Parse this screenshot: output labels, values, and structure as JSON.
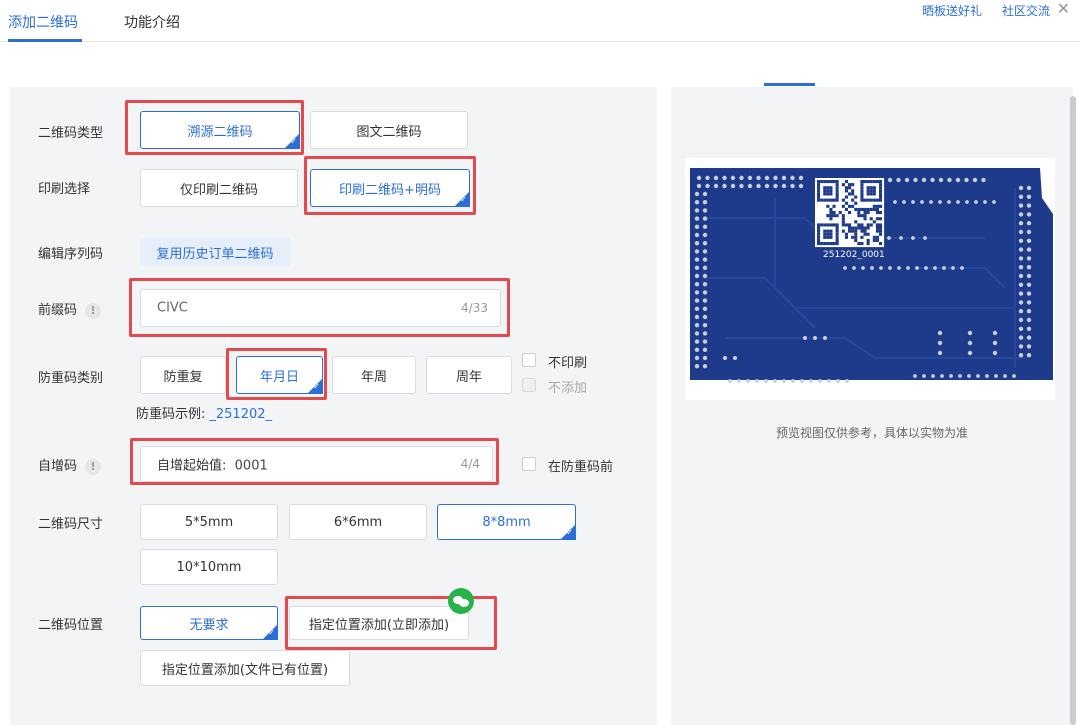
{
  "tabs": [
    {
      "label": "添加二维码",
      "active": true
    },
    {
      "label": "功能介绍",
      "active": false
    }
  ],
  "top_links": {
    "share": "晒板送好礼",
    "community": "社区交流"
  },
  "form": {
    "qr_type": {
      "label": "二维码类型",
      "options": [
        "溯源二维码",
        "图文二维码"
      ],
      "selected": "溯源二维码"
    },
    "print_choice": {
      "label": "印刷选择",
      "options": [
        "仅印刷二维码",
        "印刷二维码+明码"
      ],
      "selected": "印刷二维码+明码"
    },
    "serial": {
      "label": "编辑序列码",
      "reuse_button": "复用历史订单二维码"
    },
    "prefix": {
      "label": "前缀码",
      "value": "CIVC",
      "count": "4/33"
    },
    "anti_dup": {
      "label": "防重码类别",
      "options": [
        "防重复",
        "年月日",
        "年周",
        "周年"
      ],
      "selected": "年月日",
      "checkbox_no_print": "不印刷",
      "checkbox_no_add": "不添加",
      "example_label": "防重码示例:",
      "example_value": "_251202_"
    },
    "auto_inc": {
      "label": "自增码",
      "field_label": "自增起始值:",
      "value": "0001",
      "count": "4/4",
      "checkbox_before": "在防重码前"
    },
    "qr_size": {
      "label": "二维码尺寸",
      "options": [
        "5*5mm",
        "6*6mm",
        "8*8mm",
        "10*10mm"
      ],
      "selected": "8*8mm"
    },
    "qr_position": {
      "label": "二维码位置",
      "options": [
        "无要求",
        "指定位置添加(立即添加)",
        "指定位置添加(文件已有位置)"
      ],
      "selected": "无要求"
    }
  },
  "preview": {
    "qr_text": "251202_0001",
    "caption": "预览视图仅供参考，具体以实物为准",
    "colors": {
      "board": "#1e3a8a",
      "pad": "#c8cfd8",
      "trace": "#26489c"
    }
  },
  "colors": {
    "accent": "#2b6fd6",
    "highlight": "#e5484d"
  }
}
